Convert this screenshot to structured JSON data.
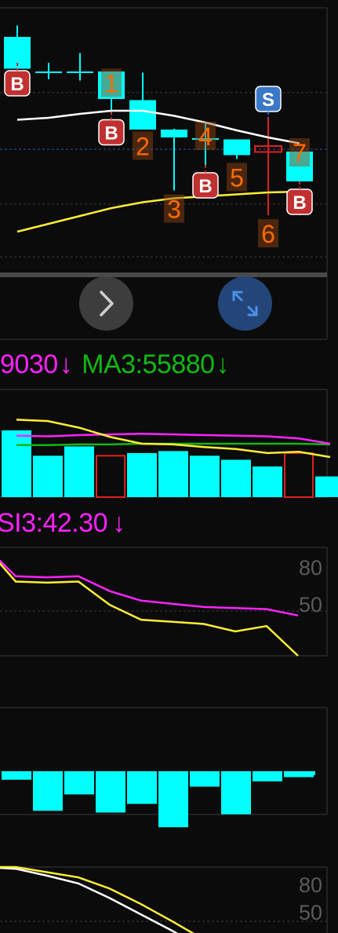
{
  "colors": {
    "bg": "#0b0b0b",
    "grid": "#3a3a3a",
    "cyan": "#00ffff",
    "red": "#e02020",
    "white": "#ffffff",
    "yellow": "#ffee33",
    "magenta": "#ff22ff",
    "green": "#12b812",
    "orange": "#ff6a00",
    "sell_blue": "#3a78c8",
    "dash_blue": "#2a6ad8"
  },
  "indicator_vol": {
    "ma_fragment": "9030",
    "ma3_label": "MA3:55880",
    "arrow": "↓"
  },
  "indicator_rsi": {
    "rsi3_label": "SI3:42.30",
    "arrow": "↓"
  },
  "axis_labels": {
    "rsi_high": "80",
    "rsi_mid": "50",
    "kdj_high": "80",
    "kdj_mid": "50"
  },
  "buttons": {
    "next_icon": "chevron-right-icon",
    "expand_icon": "expand-arrows-icon"
  },
  "chart_data": [
    {
      "type": "candlestick",
      "name": "price",
      "candles": [
        {
          "o": 30.6,
          "h": 33.5,
          "l": 24.0,
          "c": 22.5,
          "color": "cyan"
        },
        {
          "o": 21.8,
          "h": 24.0,
          "l": 19.8,
          "c": 21.8,
          "color": "cyan"
        },
        {
          "o": 21.8,
          "h": 26.5,
          "l": 19.5,
          "c": 21.8,
          "color": "cyan"
        },
        {
          "o": 21.8,
          "h": 20.5,
          "l": 11.5,
          "c": 14.8,
          "color": "cyan"
        },
        {
          "o": 14.5,
          "h": 21.5,
          "l": 7.5,
          "c": 7.0,
          "color": "cyan"
        },
        {
          "o": 7.0,
          "h": 7.2,
          "l": -8.5,
          "c": 5.0,
          "color": "cyan"
        },
        {
          "o": 4.8,
          "h": 8.5,
          "l": -2.0,
          "c": 4.8,
          "color": "cyan"
        },
        {
          "o": 4.5,
          "h": 4.5,
          "l": -0.5,
          "c": 0.5,
          "color": "cyan"
        },
        {
          "o": 1.3,
          "h": 10.0,
          "l": -14.8,
          "c": 2.8,
          "color": "red"
        },
        {
          "o": 1.4,
          "h": -2.5,
          "l": -6.2,
          "c": -6.2,
          "color": "cyan"
        }
      ],
      "ma_white": [
        9.5,
        10.0,
        11.0,
        11.8,
        11.8,
        10.5,
        8.8,
        6.8,
        5.0,
        3.5
      ],
      "ma_yellow": [
        -19.0,
        -17.0,
        -15.0,
        -13.0,
        -11.5,
        -10.5,
        -10.0,
        -9.5,
        -9.0,
        -8.8
      ],
      "signals": [
        {
          "candle": 0,
          "type": "B",
          "text": ""
        },
        {
          "candle": 3,
          "type": "B",
          "text": "1"
        },
        {
          "candle": 4,
          "type": "",
          "text": "2"
        },
        {
          "candle": 5,
          "type": "",
          "text": "3"
        },
        {
          "candle": 6,
          "type": "B",
          "text": "4"
        },
        {
          "candle": 7,
          "type": "",
          "text": "5"
        },
        {
          "candle": 8,
          "type": "S",
          "text": "6"
        },
        {
          "candle": 9,
          "type": "B",
          "text": "7"
        }
      ]
    },
    {
      "type": "bar",
      "name": "volume",
      "values": [
        100,
        62,
        76,
        62,
        66,
        69,
        62,
        56,
        46,
        66,
        31
      ],
      "bar_colors": [
        "cyan",
        "cyan",
        "cyan",
        "red",
        "cyan",
        "cyan",
        "cyan",
        "cyan",
        "cyan",
        "red",
        "cyan"
      ],
      "hollow": [
        false,
        false,
        false,
        true,
        false,
        false,
        false,
        false,
        false,
        true,
        false
      ],
      "series": [
        {
          "name": "MA3",
          "color": "green",
          "values": [
            78,
            78,
            79,
            79,
            80,
            80,
            80,
            80,
            80,
            80,
            79
          ]
        },
        {
          "name": "magenta",
          "color": "magenta",
          "values": [
            92,
            91,
            93,
            94,
            95,
            94,
            93,
            92,
            91,
            88,
            80
          ]
        },
        {
          "name": "yellow",
          "color": "yellow",
          "values": [
            116,
            114,
            104,
            90,
            80,
            79,
            75,
            72,
            66,
            68,
            60
          ]
        }
      ]
    },
    {
      "type": "line",
      "name": "rsi",
      "ylim": [
        0,
        100
      ],
      "series": [
        {
          "name": "RSI3",
          "color": "magenta",
          "values": [
            104,
            75,
            74,
            75,
            61,
            52,
            49,
            46,
            45,
            44,
            38
          ]
        },
        {
          "name": "yellow",
          "color": "yellow",
          "values": [
            104,
            70,
            69,
            70,
            48,
            34,
            32,
            30,
            23,
            28,
            0
          ]
        }
      ]
    },
    {
      "type": "bar",
      "name": "macd",
      "values": [
        -0.8,
        -4.4,
        -2.5,
        -4.6,
        -3.6,
        -6.3,
        -1.6,
        -4.8,
        -1.0,
        -0.5
      ],
      "colors": "cyan"
    },
    {
      "type": "line",
      "name": "kdj",
      "ylim": [
        0,
        100
      ],
      "series": [
        {
          "name": "white",
          "color": "white",
          "values": [
            100,
            98,
            90,
            81,
            64,
            45,
            26,
            5
          ]
        },
        {
          "name": "yellow",
          "color": "yellow",
          "values": [
            100,
            100,
            94,
            88,
            75,
            57,
            37,
            16
          ]
        }
      ]
    }
  ]
}
